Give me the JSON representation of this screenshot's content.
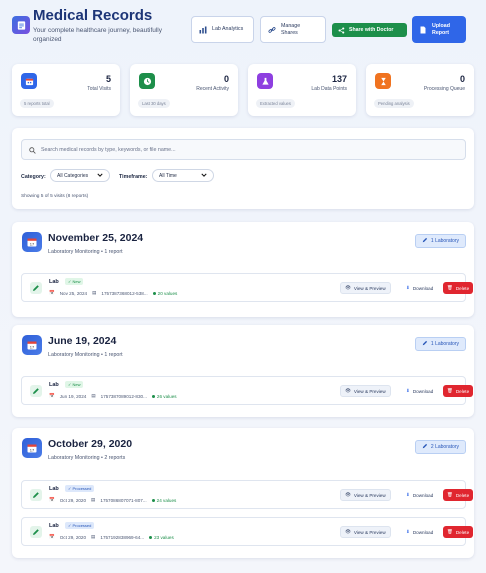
{
  "header": {
    "title": "Medical Records",
    "subtitle": "Your complete healthcare journey, beautifully organized",
    "buttons": {
      "lab_analytics": "Lab Analytics",
      "manage_shares": "Manage Shares",
      "share_doctor": "Share with Doctor",
      "upload_report": "Upload Report"
    }
  },
  "stats": [
    {
      "value": "5",
      "label": "Total Visits",
      "note": "5 reports total",
      "color": "#2f66e8",
      "icon": "calendar-icon"
    },
    {
      "value": "0",
      "label": "Recent Activity",
      "note": "Last 30 days",
      "color": "#1d8f4a",
      "icon": "clock-icon"
    },
    {
      "value": "137",
      "label": "Lab Data Points",
      "note": "Extracted values",
      "color": "#8e3fe0",
      "icon": "flask-icon"
    },
    {
      "value": "0",
      "label": "Processing Queue",
      "note": "Pending analysis",
      "color": "#f07320",
      "icon": "hourglass-icon"
    }
  ],
  "filters": {
    "search_placeholder": "Search medical records by type, keywords, or file name...",
    "category_label": "Category:",
    "category_value": "All Categories",
    "timeframe_label": "Timeframe:",
    "timeframe_value": "All Time",
    "showing": "Showing 5 of 5 visits (8 reports)"
  },
  "visits": [
    {
      "date": "November 25, 2024",
      "subtitle": "Laboratory Monitoring • 1 report",
      "badge": "1 Laboratory",
      "reports": [
        {
          "title": "Lab",
          "status": "New",
          "date": "Nov 25, 2024",
          "file": "1757387368012-538...",
          "values": "20 values"
        }
      ]
    },
    {
      "date": "June 19, 2024",
      "subtitle": "Laboratory Monitoring • 1 report",
      "badge": "1 Laboratory",
      "reports": [
        {
          "title": "Lab",
          "status": "New",
          "date": "Jun 19, 2024",
          "file": "1757387089012-830...",
          "values": "26 values"
        }
      ]
    },
    {
      "date": "October 29, 2020",
      "subtitle": "Laboratory Monitoring • 2 reports",
      "badge": "2 Laboratory",
      "reports": [
        {
          "title": "Lab",
          "status": "Processed",
          "date": "Oct 29, 2020",
          "file": "1757086807071-807...",
          "values": "24 values"
        },
        {
          "title": "Lab",
          "status": "Processed",
          "date": "Oct 29, 2020",
          "file": "1757192838969-64...",
          "values": "23 values"
        }
      ]
    }
  ],
  "actions": {
    "view": "View & Preview",
    "download": "Download",
    "delete": "Delete"
  }
}
